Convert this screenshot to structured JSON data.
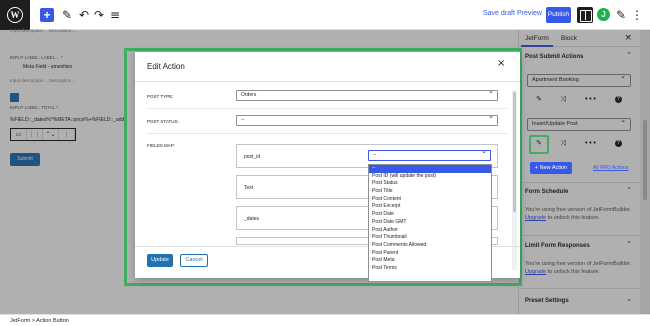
{
  "topbar": {
    "logo_icon": "wordpress-logo",
    "add_label": "+",
    "tool_icons": [
      "pencil-icon",
      "undo-icon",
      "redo-icon",
      "list-view-icon"
    ],
    "tool_glyphs": [
      "✎",
      "↶",
      "↷",
      "≡"
    ],
    "save_draft": "Save draft",
    "preview": "Preview",
    "publish": "Publish",
    "jfb_label": "J",
    "edit_glyph": "✎",
    "more_glyph": "⋮"
  },
  "editor": {
    "input_desc_1": "Input description… Description…",
    "input_label_1": "INPUT LABEL:   LABEL… *",
    "meta_field": "Meta Field - amenities",
    "input_desc_2": "Input description… Description…",
    "input_label_2": "INPUT LABEL:   TOTAL *",
    "formula": "%FIELD::_dates%*%META::price%+%FIELD::_add",
    "block_tools": [
      "▭",
      "⋮⋮",
      "⌃⌄",
      "⋮"
    ],
    "submit_label": "Submit"
  },
  "sidebar": {
    "tabs": [
      "JetForm",
      "Block"
    ],
    "close": "×",
    "post_submit_title": "Post Submit Actions",
    "action1_select": "Apartment Booking",
    "action2_select": "Insert/Update Post",
    "row_glyphs": [
      "✎",
      "⤨",
      "•••"
    ],
    "help_glyph": "?",
    "new_action": "+ New Action",
    "all_pro": "All PRO Actions",
    "form_schedule_title": "Form Schedule",
    "form_schedule_text_1": "You're using free version of JetFormBuilder.",
    "form_schedule_link": "Upgrade",
    "form_schedule_text_2": " to unlock this feature.",
    "limit_title": "Limit Form Responses",
    "limit_text_1": "You're using free version of JetFormBuilder.",
    "limit_link": "Upgrade",
    "limit_text_2": " to unlock this feature.",
    "preset_title": "Preset Settings",
    "chevron_up": "⌃",
    "chevron_down": "⌄"
  },
  "footer": {
    "breadcrumb": "JetForm  >  Action Button"
  },
  "modal": {
    "title": "Edit Action",
    "close": "×",
    "post_type_label": "POST TYPE:",
    "post_type_value": "Orders",
    "post_status_label": "POST STATUS:",
    "post_status_value": "--",
    "fields_map_label": "FIELDS MAP:",
    "field_rows": [
      "post_id",
      "Text",
      "_dates",
      ""
    ],
    "field_select_value": "--",
    "dropdown_options": [
      "--",
      "Post ID (will update the post)",
      "Post Status",
      "Post Title",
      "Post Content",
      "Post Excerpt",
      "Post Date",
      "Post Date GMT",
      "Post Author",
      "Post Thumbnail",
      "Post Comments Allowed",
      "Post Parent",
      "Post Meta",
      "Post Terms"
    ],
    "update": "Update",
    "cancel": "Cancel"
  },
  "colors": {
    "accent": "#3858e9",
    "highlight_frame": "#3fae5f",
    "button_blue": "#2271b1"
  }
}
